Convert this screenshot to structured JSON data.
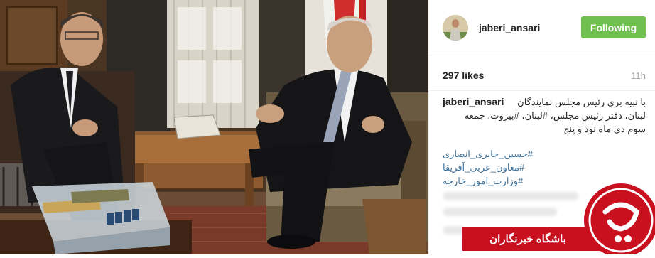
{
  "post": {
    "username": "jaberi_ansari",
    "follow_label": "Following",
    "likes": "297 likes",
    "time_ago": "11h",
    "caption": {
      "username": "jaberi_ansari",
      "lines": [
        "با نبیه بری رئیس مجلس نمایندگان",
        "لبنان، دفتر رئیس مجلس، #لبنان، #بیروت، جمعه",
        "سوم دی ماه نود و پنج"
      ],
      "hashtags": [
        "#حسین_جابری_انصاری",
        "#معاون_عربی_آفریقا",
        "#وزارت_امور_خارجه"
      ]
    }
  },
  "watermark": {
    "text": "باشگاه خبرنگاران",
    "color": "#c8101e"
  },
  "colors": {
    "follow_button": "#70c050",
    "hashtag": "#3f729b",
    "muted": "#a5a7aa"
  },
  "icons": {
    "avatar": "profile-photo",
    "logo": "ybc-logo-icon"
  }
}
